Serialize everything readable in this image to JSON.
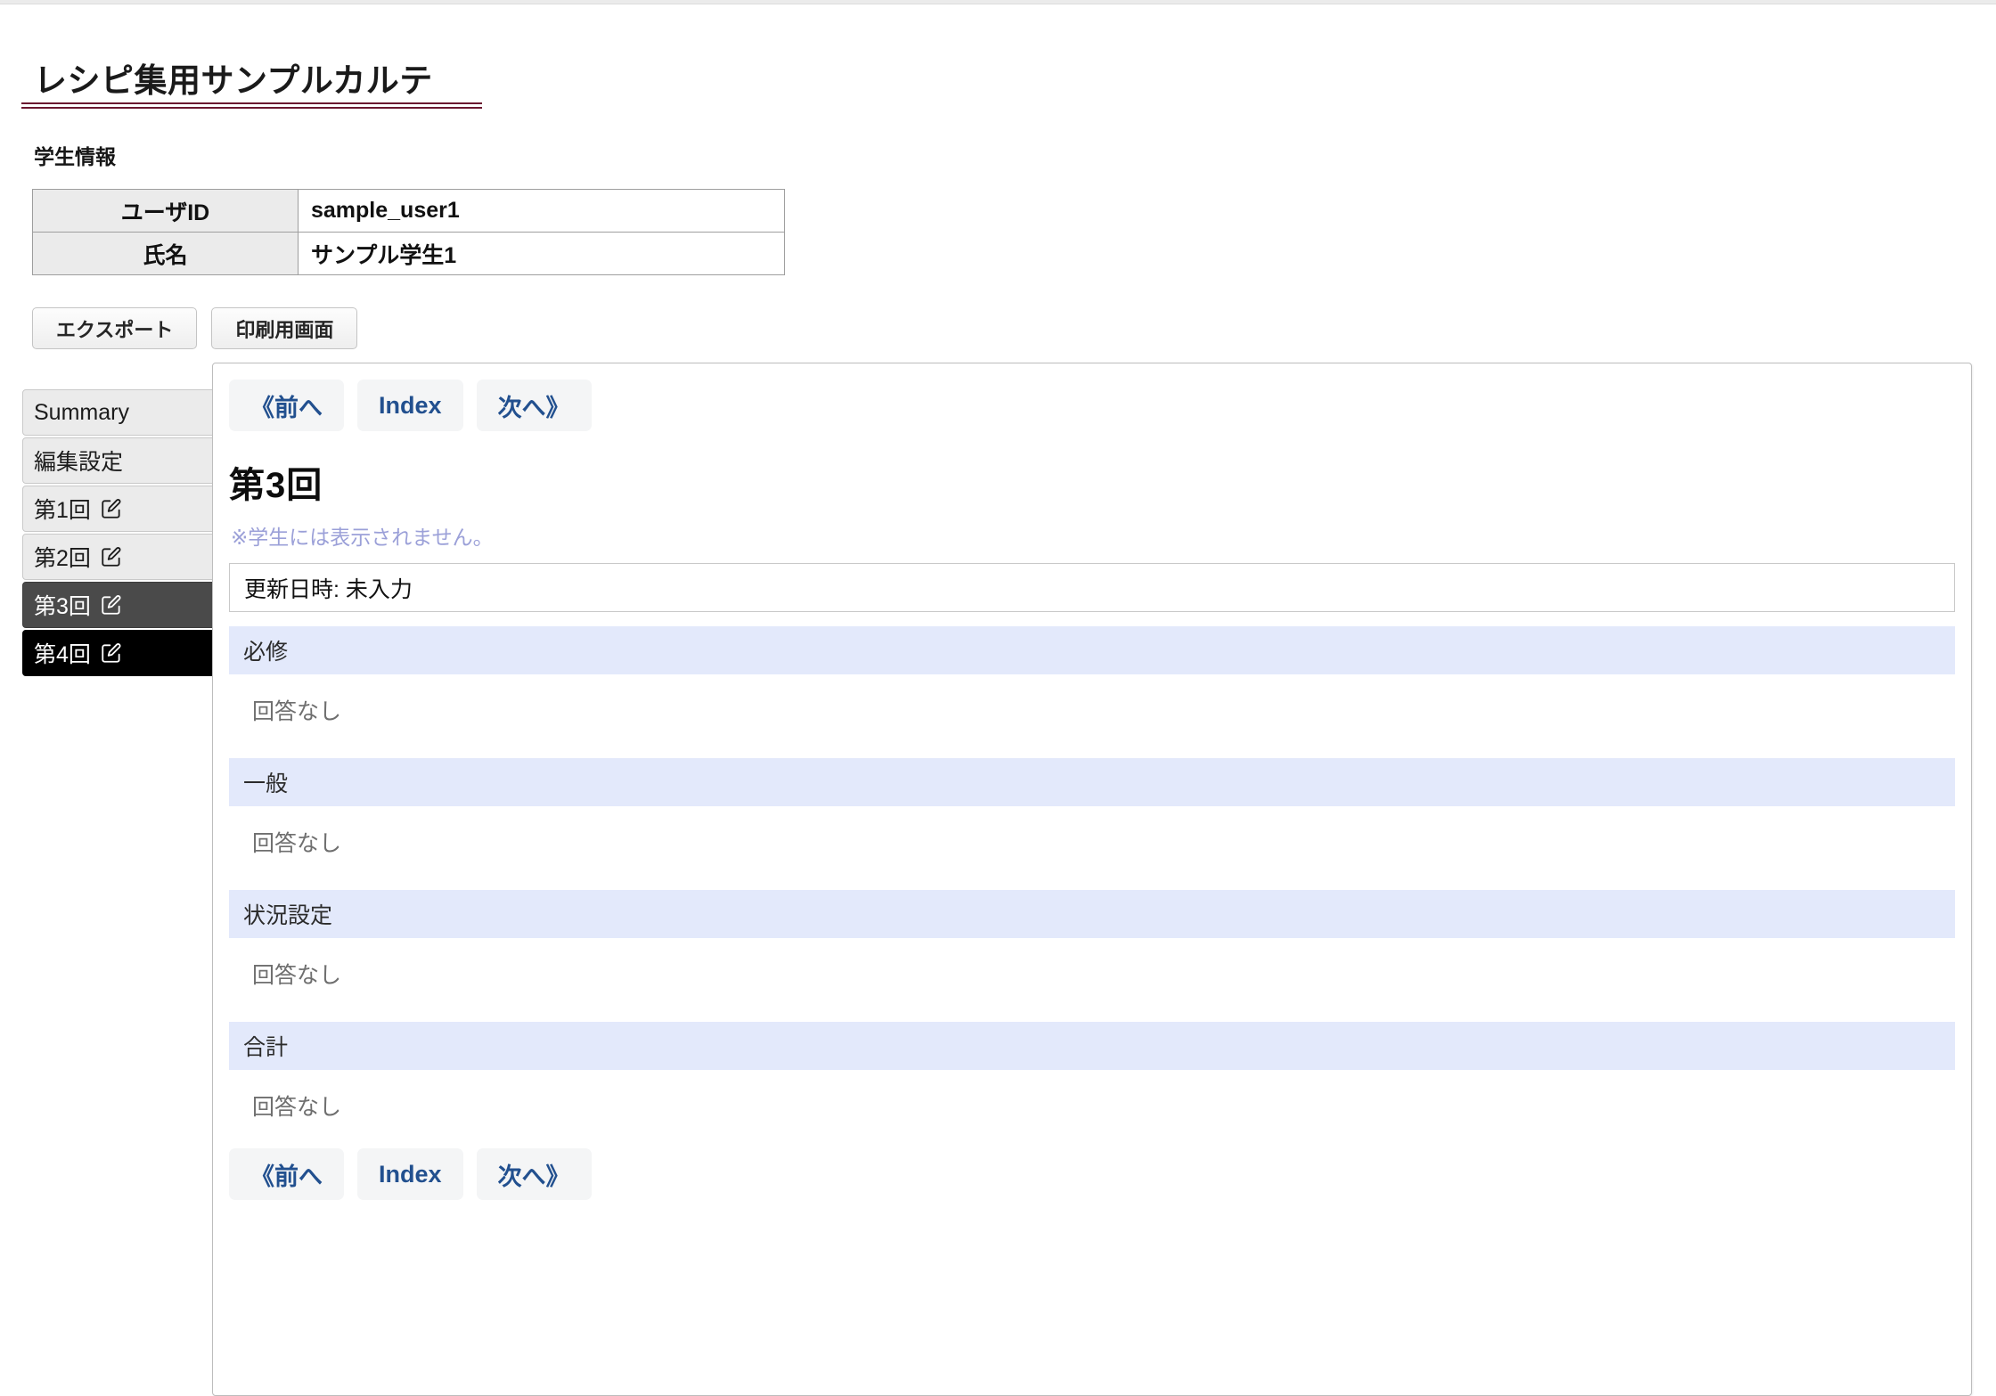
{
  "page": {
    "title": "レシピ集用サンプルカルテ",
    "student_info_label": "学生情報"
  },
  "student_info": {
    "rows": [
      {
        "label": "ユーザID",
        "value": "sample_user1"
      },
      {
        "label": "氏名",
        "value": "サンプル学生1"
      }
    ]
  },
  "toolbar": {
    "export_label": "エクスポート",
    "print_label": "印刷用画面"
  },
  "sidenav": {
    "items": [
      {
        "label": "Summary",
        "has_edit_icon": false,
        "state": "normal"
      },
      {
        "label": "編集設定",
        "has_edit_icon": false,
        "state": "normal"
      },
      {
        "label": "第1回",
        "has_edit_icon": true,
        "state": "normal"
      },
      {
        "label": "第2回",
        "has_edit_icon": true,
        "state": "normal"
      },
      {
        "label": "第3回",
        "has_edit_icon": true,
        "state": "hovered"
      },
      {
        "label": "第4回",
        "has_edit_icon": true,
        "state": "active"
      }
    ]
  },
  "card": {
    "nav": {
      "prev_label": "《前へ",
      "index_label": "Index",
      "next_label": "次へ》"
    },
    "title": "第3回",
    "note": "※学生には表示されません。",
    "update_datetime": "更新日時: 未入力",
    "sections": [
      {
        "heading": "必修",
        "body": "回答なし"
      },
      {
        "heading": "一般",
        "body": "回答なし"
      },
      {
        "heading": "状況設定",
        "body": "回答なし"
      },
      {
        "heading": "合計",
        "body": "回答なし"
      }
    ]
  },
  "colors": {
    "title_rule": "#6b1730",
    "section_header_bg": "#e3e9fb",
    "nav_button_text": "#22508f",
    "note_text": "#9ba0d8",
    "active_nav_bg": "#000000",
    "hovered_nav_bg": "#4a4a4a"
  }
}
